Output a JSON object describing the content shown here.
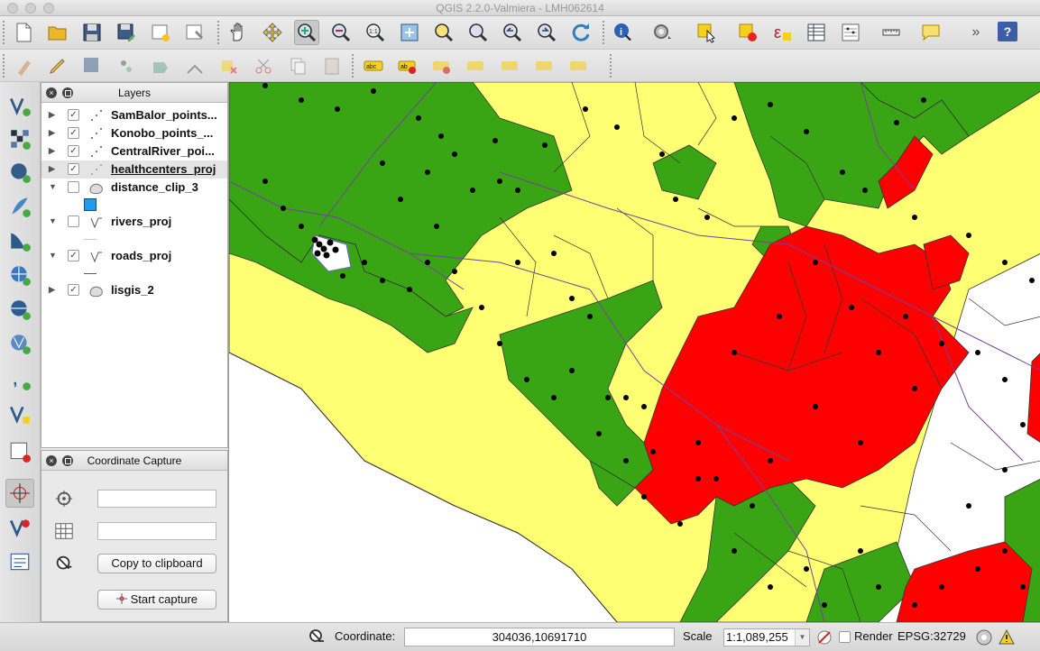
{
  "window": {
    "title": "QGIS 2.2.0-Valmiera - LMH062614"
  },
  "toolbar": {
    "overflow": "»",
    "help": "?"
  },
  "layers_panel": {
    "title": "Layers",
    "layers": [
      {
        "name": "SamBalor_points...",
        "checked": true,
        "expanded": false,
        "type": "point"
      },
      {
        "name": "Konobo_points_...",
        "checked": true,
        "expanded": false,
        "type": "point"
      },
      {
        "name": "CentralRiver_poi...",
        "checked": true,
        "expanded": false,
        "type": "point"
      },
      {
        "name": "healthcenters_proj",
        "checked": true,
        "expanded": false,
        "type": "point",
        "selected": true
      },
      {
        "name": "distance_clip_3",
        "checked": false,
        "expanded": true,
        "type": "polygon",
        "legend_color": "#1e9cf0"
      },
      {
        "name": "rivers_proj",
        "checked": false,
        "expanded": true,
        "type": "line",
        "legend_color": "#cccccc"
      },
      {
        "name": "roads_proj",
        "checked": true,
        "expanded": true,
        "type": "line",
        "legend_color": "#7a3fa0"
      },
      {
        "name": "lisgis_2",
        "checked": true,
        "expanded": false,
        "type": "polygon"
      }
    ]
  },
  "coordinate_capture": {
    "title": "Coordinate Capture",
    "field1_value": "",
    "field2_value": "",
    "copy_label": "Copy to clipboard",
    "start_label": "Start capture"
  },
  "statusbar": {
    "coordinate_label": "Coordinate:",
    "coordinate_value": "304036,10691710",
    "scale_label": "Scale",
    "scale_value": "1:1,089,255",
    "render_label": "Render",
    "render_checked": false,
    "crs": "EPSG:32729"
  },
  "colors": {
    "green": "#3aa514",
    "yellow": "#ffff73",
    "red": "#ff0000",
    "road": "#7a3fa0",
    "border": "#333333"
  },
  "icons": {
    "toolbar1": [
      "new-project-icon",
      "open-project-icon",
      "save-project-icon",
      "save-as-icon",
      "new-composer-icon",
      "composer-manager-icon",
      "pan-icon",
      "pan-to-selection-icon",
      "zoom-in-icon",
      "zoom-out-icon",
      "zoom-actual-icon",
      "zoom-full-icon",
      "zoom-selection-icon",
      "zoom-layer-icon",
      "zoom-last-icon",
      "zoom-next-icon",
      "refresh-icon",
      "identify-icon",
      "run-action-icon",
      "select-features-icon",
      "deselect-icon",
      "expression-select-icon",
      "attribute-table-icon",
      "statistics-icon",
      "measure-icon",
      "annotation-icon"
    ],
    "toolbar2": [
      "current-edits-icon",
      "toggle-editing-icon",
      "save-edits-icon",
      "add-feature-icon",
      "move-feature-icon",
      "node-tool-icon",
      "delete-selected-icon",
      "cut-features-icon",
      "copy-features-icon",
      "paste-features-icon",
      "label-tool-icon",
      "label-pin-icon",
      "label-show-hide-icon",
      "label-move-icon",
      "label-rotate-icon",
      "label-change-icon",
      "label-edit-icon"
    ],
    "left": [
      "add-vector-layer-icon",
      "add-raster-layer-icon",
      "add-postgis-layer-icon",
      "add-spatialite-layer-icon",
      "add-mssql-layer-icon",
      "add-wms-layer-icon",
      "add-wcs-layer-icon",
      "add-wfs-layer-icon",
      "add-delimited-text-icon",
      "new-shapefile-icon",
      "remove-layer-icon",
      "coordinate-capture-icon",
      "georeferencer-icon",
      "text-annotation-icon"
    ]
  }
}
